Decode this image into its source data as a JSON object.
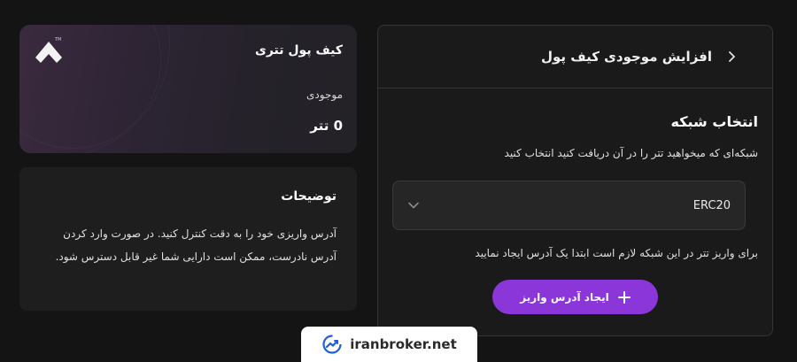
{
  "header": {
    "title": "افزایش موجودی کیف پول",
    "back_icon": "chevron-right-icon"
  },
  "network_section": {
    "title": "انتخاب شبکه",
    "description": "شبکه‌ای که میخواهید تتر را در آن دریافت کنید انتخاب کنید",
    "selected_network": "ERC20",
    "dropdown_icon": "chevron-down-icon",
    "notice": "برای واریز تتر در این شبکه لازم است ابتدا یک آدرس ایجاد نمایید",
    "create_button_label": "ایجاد آدرس واریز",
    "create_button_icon": "plus-icon"
  },
  "wallet": {
    "title": "کیف پول تتری",
    "balance_label": "موجودی",
    "balance_value": "0 تتر",
    "trademark": "TM"
  },
  "notes": {
    "title": "توضیحات",
    "body": "آدرس واریزی خود را به دقت کنترل کنید. در صورت وارد کردن آدرس نادرست، ممکن است دارایی شما غیر قابل دسترس شود."
  },
  "watermark": {
    "text": "iranbroker.net"
  },
  "colors": {
    "background": "#141414",
    "accent": "#8b36d9",
    "panel_border": "#353535"
  }
}
